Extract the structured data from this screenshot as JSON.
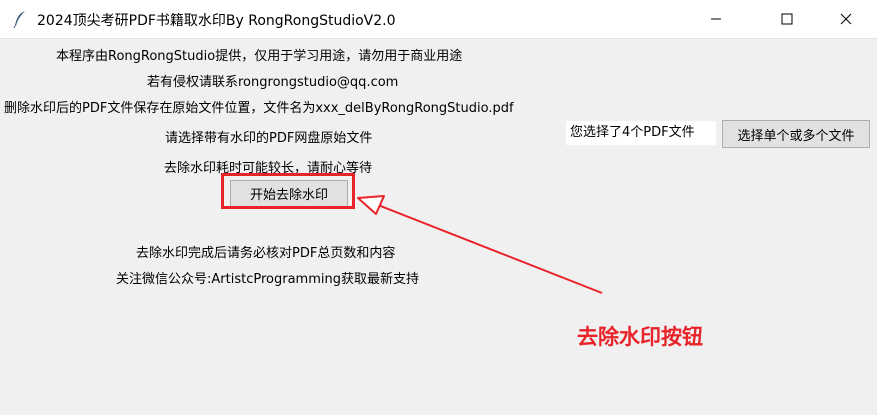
{
  "window": {
    "title": "2024顶尖考研PDF书籍取水印By RongRongStudioV2.0"
  },
  "info": {
    "line1": "本程序由RongRongStudio提供，仅用于学习用途，请勿用于商业用途",
    "line2": "若有侵权请联系rongrongstudio@qq.com",
    "line3": "删除水印后的PDF文件保存在原始文件位置，文件名为xxx_delByRongRongStudio.pdf",
    "select_prompt": "请选择带有水印的PDF网盘原始文件",
    "wait_notice": "去除水印耗时可能较长，请耐心等待",
    "check_notice": "去除水印完成后请务必核对PDF总页数和内容",
    "follow_notice": "关注微信公众号:ArtistcProgramming获取最新支持"
  },
  "file_picker": {
    "status_text": "您选择了4个PDF文件",
    "button_label": "选择单个或多个文件"
  },
  "actions": {
    "start_label": "开始去除水印"
  },
  "annotation": {
    "text": "去除水印按钮",
    "color": "#e8232a"
  },
  "icons": {
    "app": "feather-icon",
    "minimize": "minimize-icon",
    "maximize": "maximize-icon",
    "close": "close-icon"
  }
}
